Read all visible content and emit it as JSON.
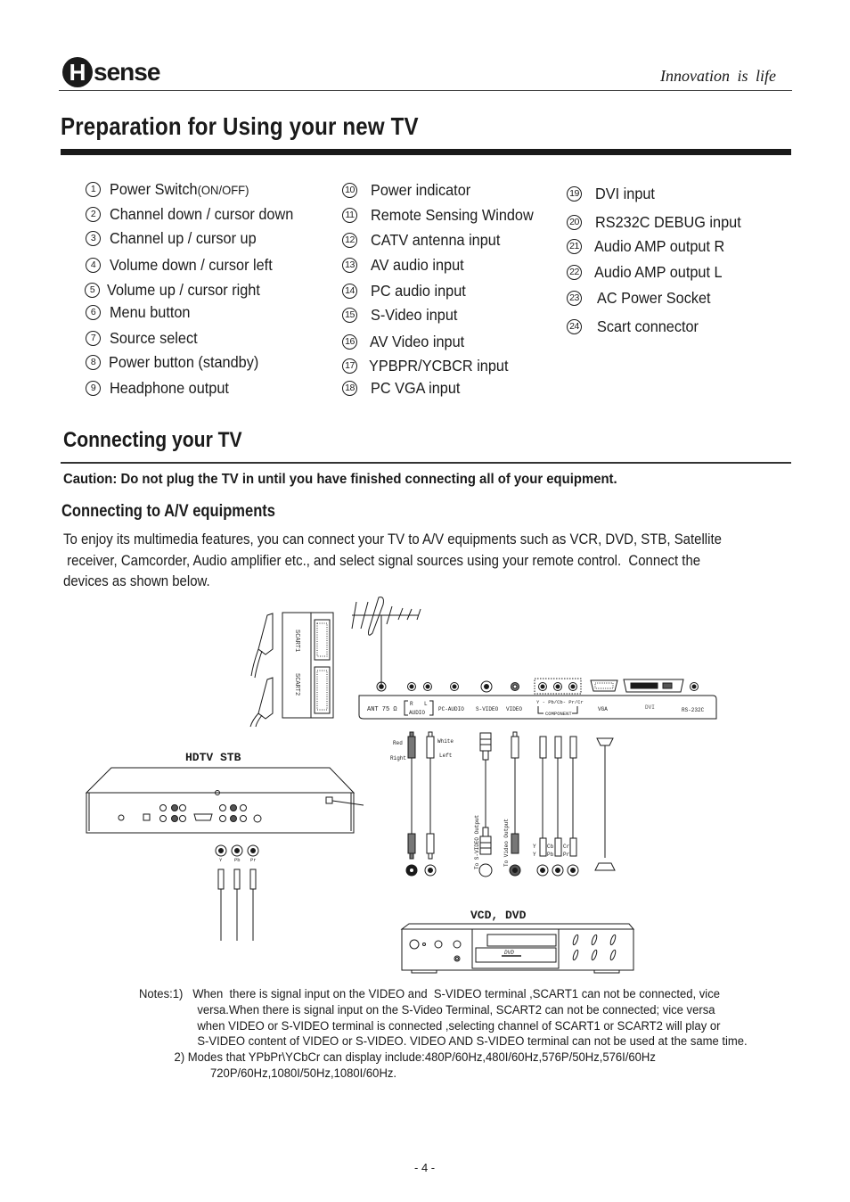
{
  "header": {
    "brand_initial": "H",
    "brand_rest": "sense",
    "tagline": "Innovation is life"
  },
  "page_title": "Preparation for Using your new TV",
  "legend": {
    "columns": [
      [
        {
          "num": "1",
          "label": "Power  Switch",
          "suffix": "(ON/OFF)"
        },
        {
          "num": "2",
          "label": "Channel down / cursor down"
        },
        {
          "num": "3",
          "label": "Channel up / cursor up"
        },
        {
          "num": "4",
          "label": "Volume down / cursor left"
        },
        {
          "num": "5",
          "label": "Volume up / cursor right"
        },
        {
          "num": "6",
          "label": "Menu  button"
        },
        {
          "num": "7",
          "label": "Source select"
        },
        {
          "num": "8",
          "label": "Power  button (standby)"
        },
        {
          "num": "9",
          "label": "Headphone output"
        }
      ],
      [
        {
          "num": "10",
          "label": "Power indicator"
        },
        {
          "num": "11",
          "label": "Remote Sensing Window"
        },
        {
          "num": "12",
          "label": "CATV antenna input"
        },
        {
          "num": "13",
          "label": "AV audio input"
        },
        {
          "num": "14",
          "label": "PC audio input"
        },
        {
          "num": "15",
          "label": "S-Video input"
        },
        {
          "num": "16",
          "label": "AV Video input"
        },
        {
          "num": "17",
          "label": "YPBPR/YCBCR input"
        },
        {
          "num": "18",
          "label": "PC VGA input"
        }
      ],
      [
        {
          "num": "19",
          "label": "DVI input"
        },
        {
          "num": "20",
          "label": "RS232C DEBUG input"
        },
        {
          "num": "21",
          "label": "Audio AMP output R"
        },
        {
          "num": "22",
          "label": "Audio AMP output L"
        },
        {
          "num": "23",
          "label": "AC Power Socket"
        },
        {
          "num": "24",
          "label": "Scart  connector"
        }
      ]
    ]
  },
  "connecting": {
    "title": "Connecting your TV",
    "caution": "Caution: Do not plug the TV in until you have finished connecting all of your equipment.",
    "subtitle": "Connecting to A/V equipments",
    "intro_lines": [
      "To enjoy its multimedia features, you can connect your TV to A/V equipments such as VCR, DVD, STB, Satellite",
      " receiver, Camcorder, Audio amplifier etc., and select signal sources using your remote control.  Connect the",
      "devices  as shown below."
    ]
  },
  "diagram": {
    "scart_labels": [
      "SCART1",
      "SCART2"
    ],
    "panel_labels": {
      "ant": "ANT  75 Ω",
      "audio_r": "R",
      "audio_l": "L",
      "audio": "AUDIO",
      "pc_audio": "PC-AUDIO",
      "s_video": "S-VIDEO",
      "video": "VIDEO",
      "component_top": "Y - Pb/Cb- Pr/Cr",
      "component": "COMPONENT",
      "vga": "VGA",
      "dvi": "DVI",
      "rs232c": "RS-232C"
    },
    "cable_labels": {
      "red": "Red",
      "right": "Right",
      "white": "White",
      "left": "Left",
      "to_svideo": "To S-VIDEO Output",
      "to_video": "To Video Output",
      "y1": "Y",
      "y2": "Y",
      "cb": "Cb",
      "pb": "Pb",
      "cr": "Cr",
      "pr": "Pr"
    },
    "stb_label": "HDTV STB",
    "stb_jacks": [
      "Y",
      "Pb",
      "Pr"
    ],
    "dvd_label": "VCD, DVD",
    "dvd_logo": "DVD"
  },
  "notes": {
    "lines": [
      "Notes:1)   When  there is signal input on the VIDEO and  S-VIDEO terminal ,SCART1 can not be connected, vice",
      "versa.When there is signal input on the S-Video Terminal, SCART2 can not be connected; vice versa",
      "when VIDEO or S-VIDEO terminal is connected ,selecting channel of SCART1 or SCART2 will play or",
      "S-VIDEO content of VIDEO or S-VIDEO. VIDEO AND S-VIDEO terminal can not  be used at the same time.",
      "2)  Modes  that YPbPr\\YCbCr can display include:480P/60Hz,480I/60Hz,576P/50Hz,576I/60Hz",
      "720P/60Hz,1080I/50Hz,1080I/60Hz."
    ]
  },
  "page_number": "- 4 -"
}
